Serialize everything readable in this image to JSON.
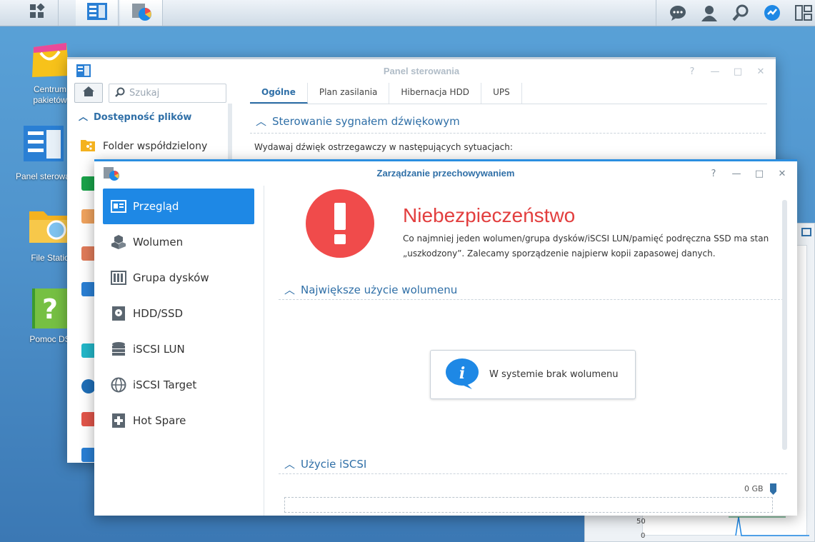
{
  "desktop_icons": [
    {
      "label": "Centrum\npakietów"
    },
    {
      "label": "Panel sterowa"
    },
    {
      "label": "File Statio"
    },
    {
      "label": "Pomoc DS"
    }
  ],
  "taskbar": {
    "left_icons": [
      "main-menu-icon",
      "control-panel-app-icon",
      "storage-manager-app-icon"
    ],
    "right_icons": [
      "chat-icon",
      "user-icon",
      "search-icon",
      "widgets-icon",
      "windows-icon"
    ]
  },
  "control_panel": {
    "title": "Panel sterowania",
    "search_placeholder": "Szukaj",
    "section": "Dostępność plików",
    "item": "Folder współdzielony",
    "tabs": [
      "Ogólne",
      "Plan zasilania",
      "Hibernacja HDD",
      "UPS"
    ],
    "active_tab": "Ogólne",
    "heading": "Sterowanie sygnałem dźwiękowym",
    "text": "Wydawaj dźwięk ostrzegawczy w następujących sytuacjach:",
    "controls": [
      "?",
      "—",
      "□",
      "✕"
    ]
  },
  "storage_manager": {
    "title": "Zarządzanie przechowywaniem",
    "controls": [
      "?",
      "—",
      "□",
      "✕"
    ],
    "sidebar": [
      {
        "label": "Przegląd",
        "icon": "overview-icon",
        "active": true
      },
      {
        "label": "Wolumen",
        "icon": "volume-icon",
        "active": false
      },
      {
        "label": "Grupa dysków",
        "icon": "disk-group-icon",
        "active": false
      },
      {
        "label": "HDD/SSD",
        "icon": "hdd-icon",
        "active": false
      },
      {
        "label": "iSCSI LUN",
        "icon": "iscsi-lun-icon",
        "active": false
      },
      {
        "label": "iSCSI Target",
        "icon": "globe-icon",
        "active": false
      },
      {
        "label": "Hot Spare",
        "icon": "hot-spare-icon",
        "active": false
      }
    ],
    "status_title": "Niebezpieczeństwo",
    "status_desc": "Co najmniej jeden wolumen/grupa dysków/iSCSI LUN/pamięć podręczna SSD ma stan „uszkodzony”. Zalecamy sporządzenie najpierw kopii zapasowej danych.",
    "section_volume": "Największe użycie wolumenu",
    "no_volume": "W systemie brak wolumenu",
    "section_iscsi": "Użycie iSCSI",
    "iscsi_value": "0 GB"
  },
  "bg_widget": {
    "axis_labels": [
      "50",
      "0"
    ]
  },
  "colors": {
    "accent": "#1e88e5",
    "danger": "#f04b4b",
    "heading": "#2f6fa7"
  }
}
